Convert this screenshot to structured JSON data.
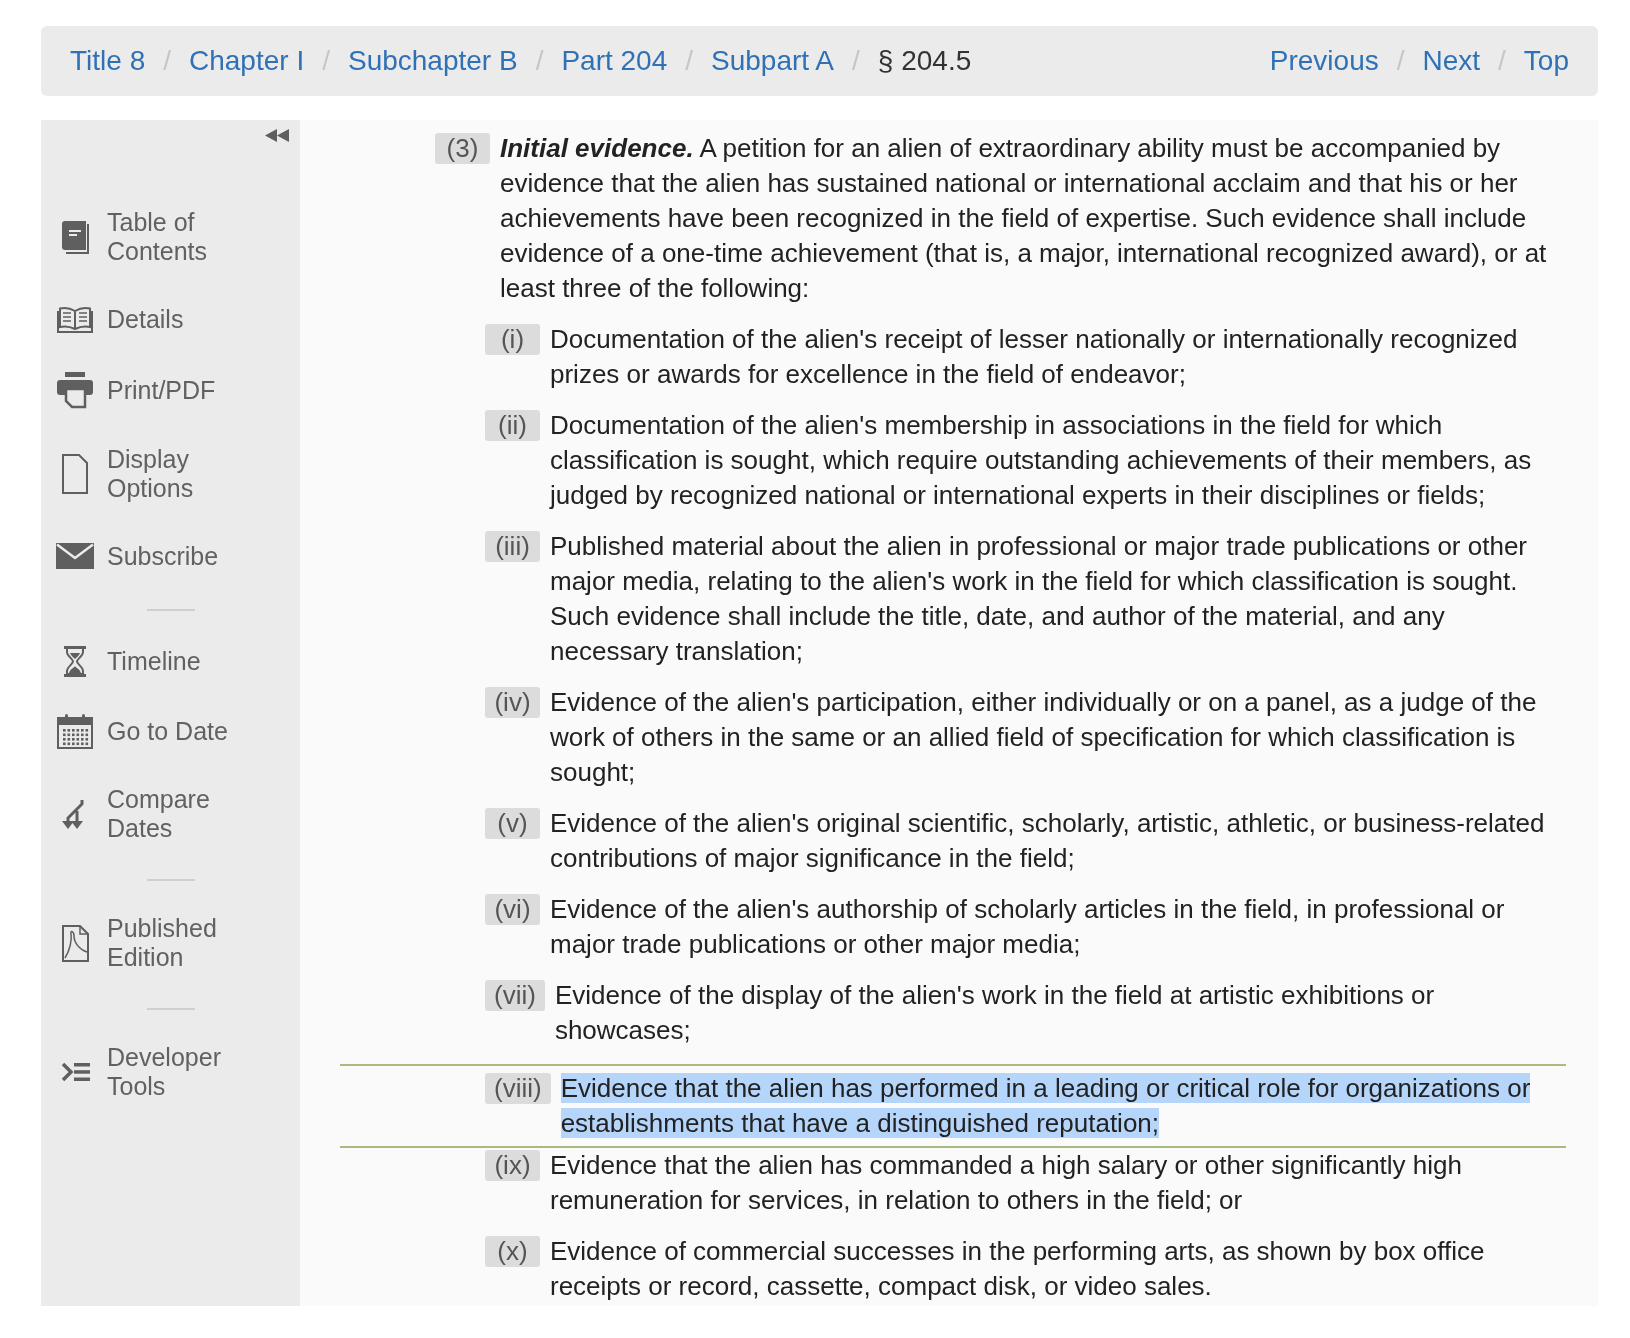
{
  "breadcrumb": [
    {
      "kind": "link",
      "label": "Title 8"
    },
    {
      "kind": "separator",
      "label": "/"
    },
    {
      "kind": "link",
      "label": "Chapter I"
    },
    {
      "kind": "separator",
      "label": "/"
    },
    {
      "kind": "link",
      "label": "Subchapter B"
    },
    {
      "kind": "separator",
      "label": "/"
    },
    {
      "kind": "link",
      "label": "Part 204"
    },
    {
      "kind": "separator",
      "label": "/"
    },
    {
      "kind": "link",
      "label": "Subpart A"
    },
    {
      "kind": "separator",
      "label": "/"
    },
    {
      "kind": "current",
      "label": "§ 204.5"
    }
  ],
  "page_nav": [
    {
      "kind": "link",
      "label": "Previous"
    },
    {
      "kind": "separator",
      "label": "/"
    },
    {
      "kind": "link",
      "label": "Next"
    },
    {
      "kind": "separator",
      "label": "/"
    },
    {
      "kind": "link",
      "label": "Top"
    }
  ],
  "sidebar": {
    "items": [
      {
        "kind": "link",
        "label": "Table of Contents"
      },
      {
        "kind": "link",
        "label": "Details"
      },
      {
        "kind": "link",
        "label": "Print/PDF"
      },
      {
        "kind": "link",
        "label": "Display Options"
      },
      {
        "kind": "link",
        "label": "Subscribe"
      },
      {
        "kind": "divider"
      },
      {
        "kind": "link",
        "label": "Timeline"
      },
      {
        "kind": "link",
        "label": "Go to Date"
      },
      {
        "kind": "link",
        "label": "Compare Dates"
      },
      {
        "kind": "divider"
      },
      {
        "kind": "link",
        "label": "Published Edition"
      },
      {
        "kind": "divider"
      },
      {
        "kind": "link",
        "label": "Developer Tools"
      }
    ]
  },
  "section": {
    "label": "(3)",
    "heading": "Initial evidence.",
    "text": "A petition for an alien of extraordinary ability must be accompanied by evidence that the alien has sustained national or international acclaim and that his or her achievements have been recognized in the field of expertise. Such evidence shall include evidence of a one-time achievement (that is, a major, international recognized award), or at least three of the following:",
    "children": [
      {
        "label": "(i)",
        "text": "Documentation of the alien's receipt of lesser nationally or internationally recognized prizes or awards for excellence in the field of endeavor;",
        "highlighted": false
      },
      {
        "label": "(ii)",
        "text": "Documentation of the alien's membership in associations in the field for which classification is sought, which require outstanding achievements of their members, as judged by recognized national or international experts in their disciplines or fields;",
        "highlighted": false
      },
      {
        "label": "(iii)",
        "text": "Published material about the alien in professional or major trade publications or other major media, relating to the alien's work in the field for which classification is sought. Such evidence shall include the title, date, and author of the material, and any necessary translation;",
        "highlighted": false
      },
      {
        "label": "(iv)",
        "text": "Evidence of the alien's participation, either individually or on a panel, as a judge of the work of others in the same or an allied field of specification for which classification is sought;",
        "highlighted": false
      },
      {
        "label": "(v)",
        "text": "Evidence of the alien's original scientific, scholarly, artistic, athletic, or business-related contributions of major significance in the field;",
        "highlighted": false
      },
      {
        "label": "(vi)",
        "text": "Evidence of the alien's authorship of scholarly articles in the field, in professional or major trade publications or other major media;",
        "highlighted": false
      },
      {
        "label": "(vii)",
        "text": "Evidence of the display of the alien's work in the field at artistic exhibitions or showcases;",
        "highlighted": false
      },
      {
        "label": "(viii)",
        "text": "Evidence that the alien has performed in a leading or critical role for organizations or establishments that have a distinguished reputation;",
        "highlighted": true
      },
      {
        "label": "(ix)",
        "text": "Evidence that the alien has commanded a high salary or other significantly high remuneration for services, in relation to others in the field; or",
        "highlighted": false
      },
      {
        "label": "(x)",
        "text": "Evidence of commercial successes in the performing arts, as shown by box office receipts or record, cassette, compact disk, or video sales.",
        "highlighted": false
      }
    ]
  }
}
